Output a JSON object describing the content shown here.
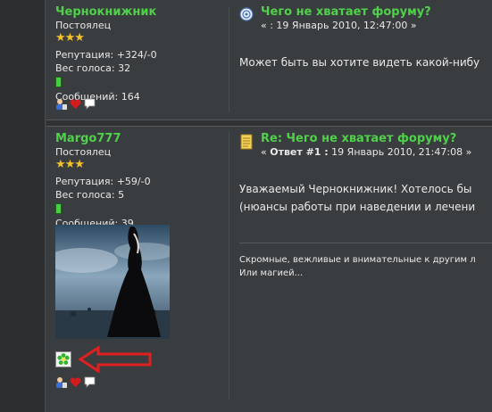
{
  "posts": [
    {
      "author": {
        "name": "Чернокнижник",
        "rank": "Постоялец",
        "stars": "★★★",
        "reputation": "Репутация: +324/-0",
        "vote_weight": "Вес голоса: 32",
        "messages": "Сообщений: 164"
      },
      "title": "Чего не хватает форуму?",
      "meta": "« : 19 Январь 2010, 12:47:00 »",
      "body": "Может быть вы хотите видеть какой-нибу"
    },
    {
      "author": {
        "name": "Margo777",
        "rank": "Постоялец",
        "stars": "★★★",
        "reputation": "Репутация: +59/-0",
        "vote_weight": "Вес голоса: 5",
        "messages": "Сообщений: 39"
      },
      "title": "Re: Чего не хватает форуму?",
      "meta_prefix": "« ",
      "meta_bold": "Ответ #1 :",
      "meta_rest": " 19 Январь 2010, 21:47:08 »",
      "body_lines": [
        "Уважаемый  Чернокнижник! Хотелось бы",
        "(нюансы работы при наведении и лечени"
      ],
      "signature_lines": [
        "Скромные, вежливые и внимательные к другим л",
        "Или магией..."
      ]
    }
  ],
  "icons": {
    "profile": "profile-icon",
    "karma": "heart-icon",
    "pm": "speech-bubble-icon",
    "icq": "icq-flower-icon",
    "annotation": "red-arrow-annotation"
  },
  "colors": {
    "accent_green": "#4fd14a",
    "star_gold": "#f3c12b",
    "background": "#3a3d3f",
    "arrow_red": "#e02020"
  }
}
